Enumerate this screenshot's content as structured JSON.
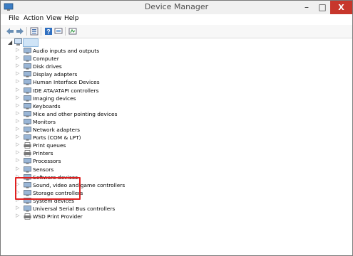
{
  "window": {
    "title": "Device Manager",
    "close_label": "X",
    "minimize_label": "–",
    "maximize_label": "□"
  },
  "menu": [
    "File",
    "Action",
    "View",
    "Help"
  ],
  "toolbar": {
    "icons": [
      "back-icon",
      "forward-icon",
      "properties-icon",
      "help-icon",
      "scan-hardware-icon"
    ]
  },
  "tree": {
    "items": [
      {
        "label": "Audio inputs and outputs",
        "icon": "speaker-icon"
      },
      {
        "label": "Computer",
        "icon": "computer-icon"
      },
      {
        "label": "Disk drives",
        "icon": "disk-icon"
      },
      {
        "label": "Display adapters",
        "icon": "display-adapter-icon"
      },
      {
        "label": "Human Interface Devices",
        "icon": "hid-icon"
      },
      {
        "label": "IDE ATA/ATAPI controllers",
        "icon": "ide-icon"
      },
      {
        "label": "Imaging devices",
        "icon": "camera-icon"
      },
      {
        "label": "Keyboards",
        "icon": "keyboard-icon"
      },
      {
        "label": "Mice and other pointing devices",
        "icon": "mouse-icon"
      },
      {
        "label": "Monitors",
        "icon": "monitor-icon"
      },
      {
        "label": "Network adapters",
        "icon": "network-icon"
      },
      {
        "label": "Ports (COM & LPT)",
        "icon": "port-icon"
      },
      {
        "label": "Print queues",
        "icon": "printer-icon"
      },
      {
        "label": "Printers",
        "icon": "printer-icon"
      },
      {
        "label": "Processors",
        "icon": "processor-icon"
      },
      {
        "label": "Sensors",
        "icon": "sensor-icon"
      },
      {
        "label": "Software devices",
        "icon": "software-icon"
      },
      {
        "label": "Sound, video and game controllers",
        "icon": "sound-icon"
      },
      {
        "label": "Storage controllers",
        "icon": "storage-icon"
      },
      {
        "label": "System devices",
        "icon": "system-icon"
      },
      {
        "label": "Universal Serial Bus controllers",
        "icon": "usb-icon"
      },
      {
        "label": "WSD Print Provider",
        "icon": "wsd-printer-icon"
      }
    ]
  },
  "colors": {
    "highlight": "#e02020",
    "close_button": "#c7372c",
    "selection": "#cfe4f7"
  }
}
